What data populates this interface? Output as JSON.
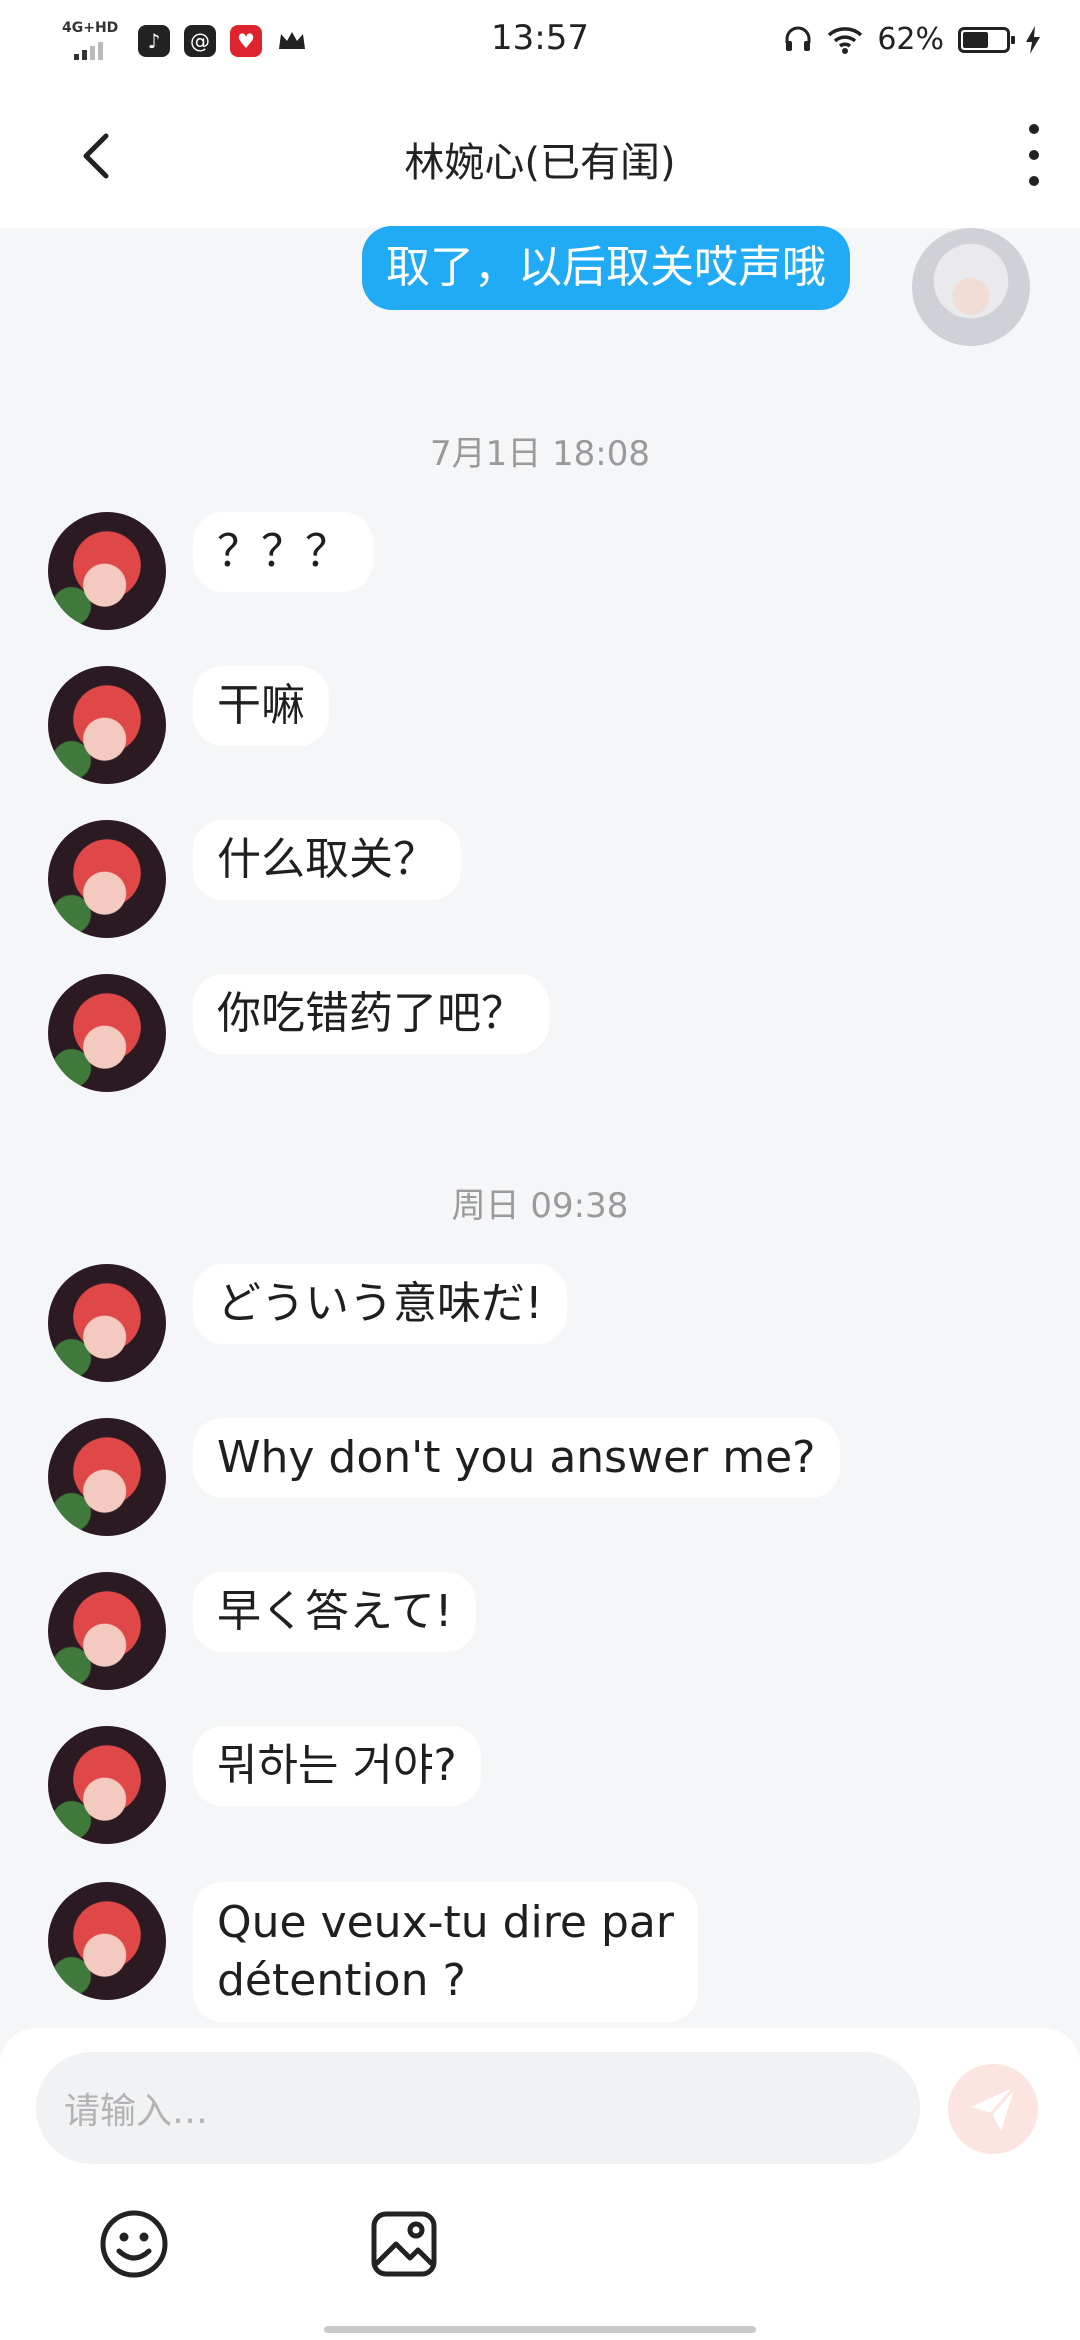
{
  "status_bar": {
    "network_label": "4G+HD",
    "time": "13:57",
    "battery_percent": "62%",
    "battery_level": 0.62,
    "app_icons": [
      "tiktok-icon",
      "at-icon",
      "heart-app-icon",
      "crown-icon"
    ]
  },
  "header": {
    "title": "林婉心(已有闺)"
  },
  "messages": [
    {
      "sender": "me",
      "text": "取了，以后取关哎声哦"
    },
    {
      "timestamp": "7月1日 18:08"
    },
    {
      "sender": "friend",
      "text": "？？？"
    },
    {
      "sender": "friend",
      "text": "干嘛"
    },
    {
      "sender": "friend",
      "text": "什么取关？"
    },
    {
      "sender": "friend",
      "text": "你吃错药了吧？"
    },
    {
      "timestamp": "周日 09:38"
    },
    {
      "sender": "friend",
      "text": "どういう意味だ!"
    },
    {
      "sender": "friend",
      "text": "Why don't you answer me?"
    },
    {
      "sender": "friend",
      "text": "早く答えて!"
    },
    {
      "sender": "friend",
      "text": "뭐하는 거야?"
    },
    {
      "sender": "friend",
      "text_line1": "Que veux-tu dire par",
      "text_line2": "détention ?"
    }
  ],
  "input": {
    "placeholder": "请输入…"
  },
  "colors": {
    "my_bubble": "#22abf5",
    "friend_bubble": "#ffffff",
    "background": "#f5f6f8",
    "send_button": "#fce4e1"
  },
  "icons": {
    "back": "chevron-left-icon",
    "more": "more-vertical-icon",
    "send": "send-icon",
    "emoji": "emoji-icon",
    "image": "image-icon"
  }
}
